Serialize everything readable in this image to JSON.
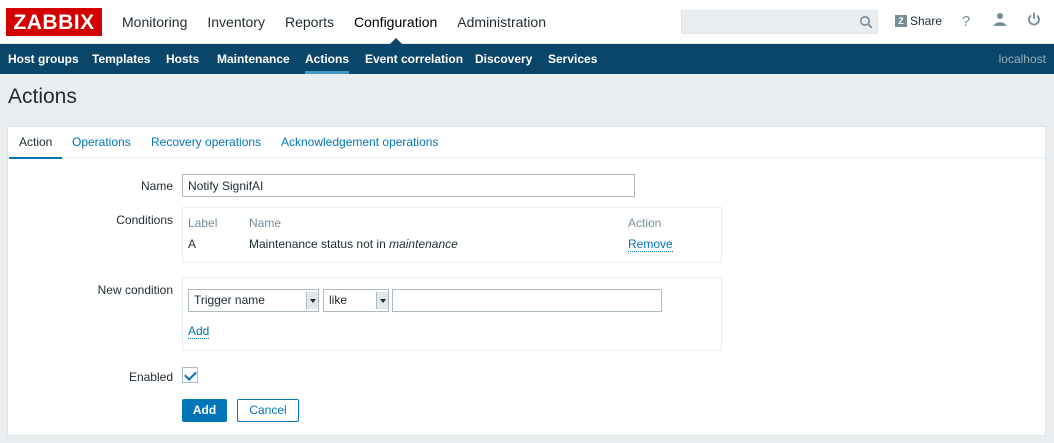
{
  "logo": {
    "text": "ZABBIX"
  },
  "main_menu": [
    {
      "label": "Monitoring"
    },
    {
      "label": "Inventory"
    },
    {
      "label": "Reports"
    },
    {
      "label": "Configuration",
      "active": true
    },
    {
      "label": "Administration"
    }
  ],
  "search": {
    "value": "",
    "placeholder": ""
  },
  "header_actions": {
    "share_label": "Share",
    "share_badge": "Z",
    "help": "?"
  },
  "sub_menu": [
    {
      "label": "Host groups"
    },
    {
      "label": "Templates"
    },
    {
      "label": "Hosts"
    },
    {
      "label": "Maintenance"
    },
    {
      "label": "Actions",
      "active": true
    },
    {
      "label": "Event correlation"
    },
    {
      "label": "Discovery"
    },
    {
      "label": "Services"
    }
  ],
  "server_name": "localhost",
  "page_title": "Actions",
  "tabs": [
    {
      "label": "Action",
      "active": true
    },
    {
      "label": "Operations"
    },
    {
      "label": "Recovery operations"
    },
    {
      "label": "Acknowledgement operations"
    }
  ],
  "form": {
    "name_label": "Name",
    "name_value": "Notify SignifAI",
    "conditions_label": "Conditions",
    "conditions_table": {
      "headers": {
        "label": "Label",
        "name": "Name",
        "action": "Action"
      },
      "rows": [
        {
          "label": "A",
          "name_prefix": "Maintenance status not in ",
          "name_emph": "maintenance",
          "action": "Remove"
        }
      ]
    },
    "new_condition_label": "New condition",
    "new_condition": {
      "type_selected": "Trigger name",
      "operator_selected": "like",
      "value": "",
      "add_link": "Add"
    },
    "enabled_label": "Enabled",
    "enabled": true,
    "add_button": "Add",
    "cancel_button": "Cancel"
  },
  "colors": {
    "brand_red": "#d40000",
    "nav_blue": "#0a466a",
    "link_blue": "#0275b8",
    "background": "#ebeef0"
  }
}
